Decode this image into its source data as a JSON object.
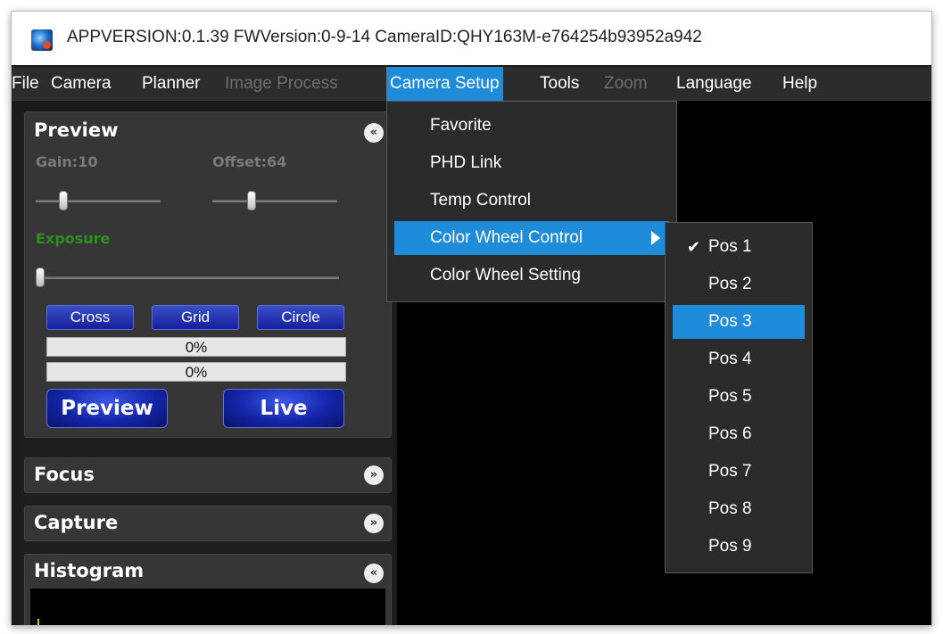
{
  "window": {
    "title": "APPVERSION:0.1.39  FWVersion:0-9-14  CameraID:QHY163M-e764254b93952a942"
  },
  "menubar": {
    "items": [
      {
        "label": "File",
        "state": "normal"
      },
      {
        "label": "Camera",
        "state": "normal"
      },
      {
        "label": "Planner",
        "state": "normal"
      },
      {
        "label": "Image Process",
        "state": "disabled"
      },
      {
        "label": "Camera Setup",
        "state": "active"
      },
      {
        "label": "Tools",
        "state": "normal"
      },
      {
        "label": "Zoom",
        "state": "disabled"
      },
      {
        "label": "Language",
        "state": "normal"
      },
      {
        "label": "Help",
        "state": "normal"
      }
    ]
  },
  "camera_setup_menu": {
    "items": [
      {
        "label": "Favorite"
      },
      {
        "label": "PHD Link"
      },
      {
        "label": "Temp Control"
      },
      {
        "label": "Color Wheel Control",
        "has_submenu": true,
        "highlighted": true
      },
      {
        "label": "Color Wheel Setting"
      }
    ]
  },
  "color_wheel_submenu": {
    "check_mark": "✔",
    "items": [
      {
        "label": "Pos 1",
        "checked": true
      },
      {
        "label": "Pos 2"
      },
      {
        "label": "Pos 3",
        "highlighted": true
      },
      {
        "label": "Pos 4"
      },
      {
        "label": "Pos 5"
      },
      {
        "label": "Pos 6"
      },
      {
        "label": "Pos 7"
      },
      {
        "label": "Pos 8"
      },
      {
        "label": "Pos 9"
      }
    ]
  },
  "preview": {
    "title": "Preview",
    "collapse_icon": "chevron-up-double-icon",
    "gain_label": "Gain:10",
    "offset_label": "Offset:64",
    "exposure_label": "Exposure",
    "gain_level": 0.2,
    "offset_level": 0.3,
    "exposure_level": 0.0,
    "cross_label": "Cross",
    "grid_label": "Grid",
    "circle_label": "Circle",
    "progress1": "0%",
    "progress2": "0%",
    "preview_button": "Preview",
    "live_button": "Live"
  },
  "sections": {
    "focus": "Focus",
    "capture": "Capture",
    "histogram": "Histogram"
  },
  "icons": {
    "collapse_up": "«",
    "collapse_down": "»"
  },
  "colors": {
    "accent": "#1e8cd8",
    "exposure_label": "#2f8f20",
    "button_blue": "#1425a8"
  }
}
